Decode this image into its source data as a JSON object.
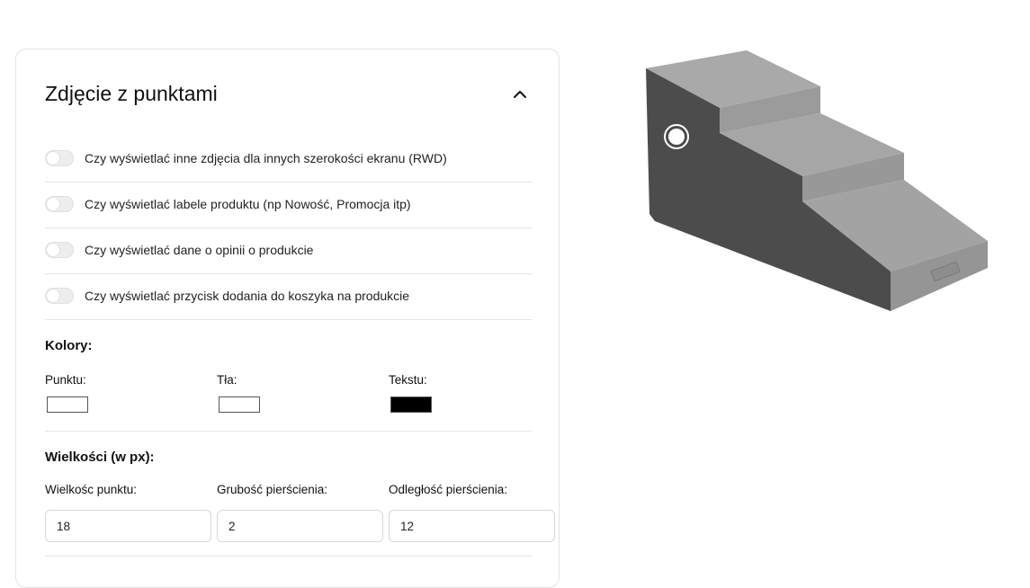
{
  "panel": {
    "title": "Zdjęcie z punktami"
  },
  "toggles": [
    {
      "label": "Czy wyświetlać inne zdjęcia dla innych szerokości ekranu (RWD)",
      "checked": false
    },
    {
      "label": "Czy wyświetlać labele produktu (np Nowość, Promocja itp)",
      "checked": false
    },
    {
      "label": "Czy wyświetlać dane o opinii o produkcie",
      "checked": false
    },
    {
      "label": "Czy wyświetlać przycisk dodania do koszyka na produkcie",
      "checked": false
    }
  ],
  "colors": {
    "heading": "Kolory:",
    "point_label": "Punktu:",
    "point_value": "#ffffff",
    "background_label": "Tła:",
    "background_value": "#ffffff",
    "text_label": "Tekstu:",
    "text_value": "#000000"
  },
  "sizes": {
    "heading": "Wielkości (w px):",
    "point_size_label": "Wielkośc punktu:",
    "point_size_value": "18",
    "ring_width_label": "Grubość pierścienia:",
    "ring_width_value": "2",
    "ring_distance_label": "Odległość pierścienia:",
    "ring_distance_value": "12"
  },
  "image": {
    "icon": "pet-stairs-product-image",
    "hotspot_icon": "hotspot-point-icon"
  }
}
